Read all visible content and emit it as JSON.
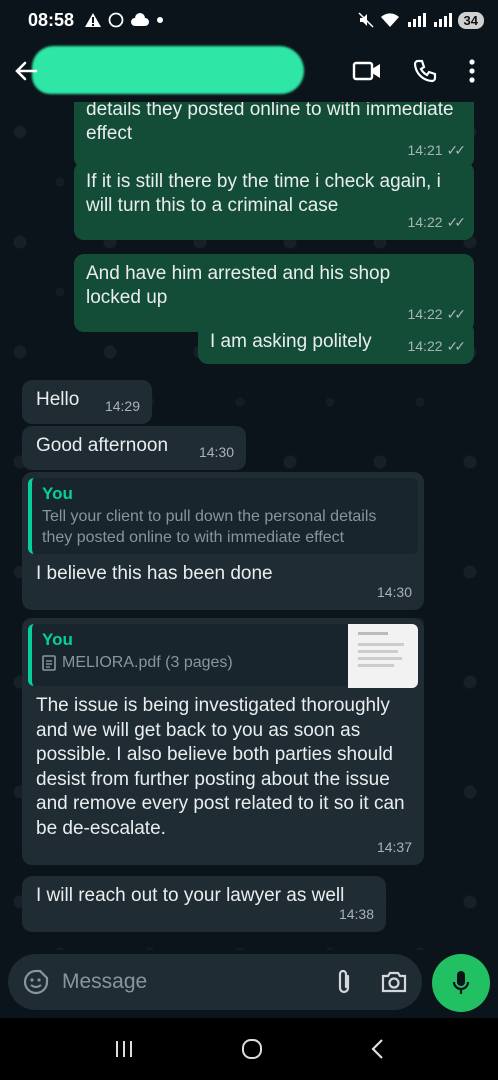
{
  "status_bar": {
    "time": "08:58",
    "battery": "34"
  },
  "header": {
    "contact_name": "",
    "icons": [
      "back-arrow-icon",
      "video-call-icon",
      "voice-call-icon",
      "more-vert-icon"
    ]
  },
  "messages": [
    {
      "direction": "out",
      "text": "details they posted online to with immediate effect",
      "time": "14:21"
    },
    {
      "direction": "out",
      "text": "If it is still there by the time i check again, i will turn this to a criminal case",
      "time": "14:22"
    },
    {
      "direction": "out",
      "text": "And have him arrested and his shop locked up",
      "time": "14:22"
    },
    {
      "direction": "out",
      "text": "I am asking politely",
      "time": "14:22"
    },
    {
      "direction": "in",
      "text": "Hello",
      "time": "14:29"
    },
    {
      "direction": "in",
      "text": "Good afternoon",
      "time": "14:30"
    },
    {
      "direction": "in",
      "quote_author": "You",
      "quote_text": "Tell your client to pull down the personal details they posted online to with immediate effect",
      "text": "I believe this has been done",
      "time": "14:30"
    },
    {
      "direction": "in",
      "quote_author": "You",
      "quote_text": "MELIORA.pdf (3 pages)",
      "text": "The issue is being investigated thoroughly and we will get back to you as soon as possible. I also believe both parties should desist from further posting about the  issue and remove every post related to it so it can be de-escalate.",
      "time": "14:37"
    },
    {
      "direction": "in",
      "text": "I will reach out to your lawyer as well",
      "time": "14:38"
    }
  ],
  "composer": {
    "placeholder": "Message"
  },
  "colors": {
    "outgoing_bubble": "#144d37",
    "incoming_bubble": "#1f2c33",
    "accent": "#21c063",
    "quote_accent": "#06cf9c"
  }
}
